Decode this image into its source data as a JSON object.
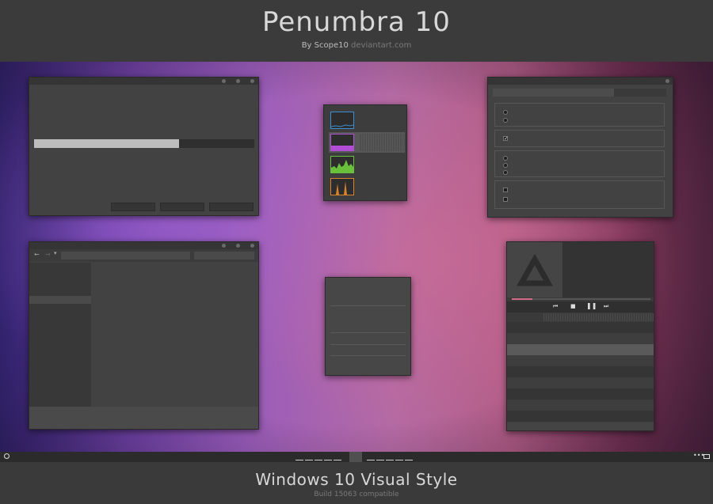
{
  "header": {
    "title": "Penumbra 10",
    "byline_author": "By Scope10",
    "byline_site": "deviantart.com"
  },
  "footer": {
    "title": "Windows 10 Visual Style",
    "subtitle": "Build 15063 compatible"
  },
  "progress_window": {
    "progress_fraction": 0.66
  },
  "task_manager": {
    "graph_colors": [
      "#3b8fd0",
      "#b04fd6",
      "#69c03a",
      "#d9822b"
    ]
  },
  "media_player": {
    "seek_fraction": 0.15,
    "accent": "#d26a8a"
  },
  "taskbar": {
    "start_icon": "circle-icon",
    "tray_icons": [
      "more-icon",
      "notification-icon"
    ]
  },
  "colors": {
    "window_bg": "#424242",
    "titlebar": "#353535"
  }
}
